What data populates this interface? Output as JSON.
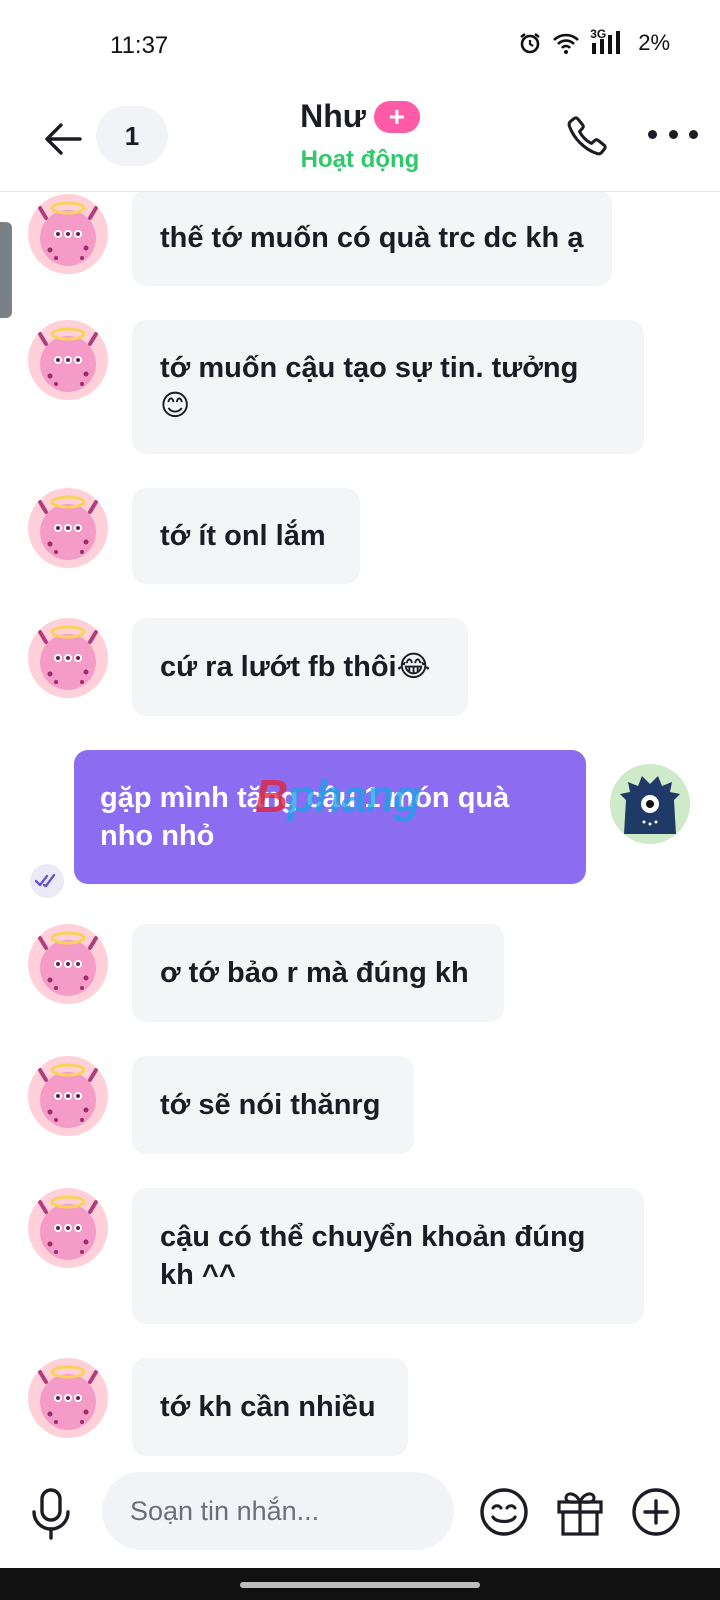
{
  "status_bar": {
    "time": "11:37",
    "network": "3G",
    "battery": "2%"
  },
  "header": {
    "unread_count": "1",
    "contact_name": "Như",
    "plus_badge": "+",
    "presence": "Hoạt động"
  },
  "messages": [
    {
      "direction": "incoming",
      "text": "thế tớ muốn có quà trc dc kh ạ"
    },
    {
      "direction": "incoming",
      "text": "tớ muốn cậu tạo sự tin. tưởng\n😊"
    },
    {
      "direction": "incoming",
      "text": "tớ ít onl lắm"
    },
    {
      "direction": "incoming",
      "text": "cứ ra lướt fb thôi😂"
    },
    {
      "direction": "outgoing",
      "text": "gặp mình tặng cậu 1 món quà\nnho nhỏ"
    },
    {
      "direction": "incoming",
      "text": "ơ tớ bảo r mà đúng kh"
    },
    {
      "direction": "incoming",
      "text": "tớ sẽ nói thănrg"
    },
    {
      "direction": "incoming",
      "text": "cậu có thể chuyển khoản đúng\nkh ^^"
    },
    {
      "direction": "incoming",
      "text": "tớ kh cần nhiều"
    }
  ],
  "watermark": {
    "part1": "B",
    "part2": "phang"
  },
  "composer": {
    "placeholder": "Soạn tin nhắn..."
  },
  "colors": {
    "accent": "#8c6cf0",
    "presence": "#30c96a",
    "badge": "#ff5aa5",
    "incoming_bubble": "#f4f5f7"
  },
  "icons": [
    "back-icon",
    "phone-icon",
    "more-icon",
    "read-receipt-icon",
    "mic-icon",
    "emoji-icon",
    "gift-icon",
    "plus-circle-icon",
    "alarm-icon",
    "wifi-icon",
    "signal-icon"
  ]
}
